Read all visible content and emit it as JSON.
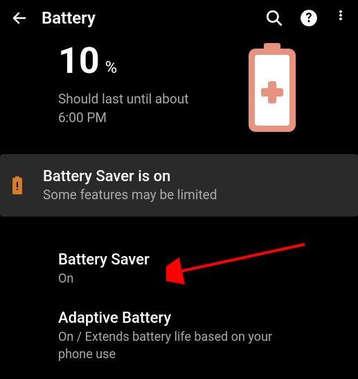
{
  "header": {
    "title": "Battery"
  },
  "battery": {
    "percent": "10",
    "percent_symbol": "%",
    "estimate_line1": "Should last until about",
    "estimate_line2": "6:00 PM"
  },
  "saver_notice": {
    "title": "Battery Saver is on",
    "subtitle": "Some features may be limited"
  },
  "settings": {
    "battery_saver": {
      "title": "Battery Saver",
      "status": "On"
    },
    "adaptive_battery": {
      "title": "Adaptive Battery",
      "status": "On / Extends battery life based on your phone use"
    }
  },
  "colors": {
    "accent": "#e89280",
    "saver_icon": "#d67b28"
  }
}
